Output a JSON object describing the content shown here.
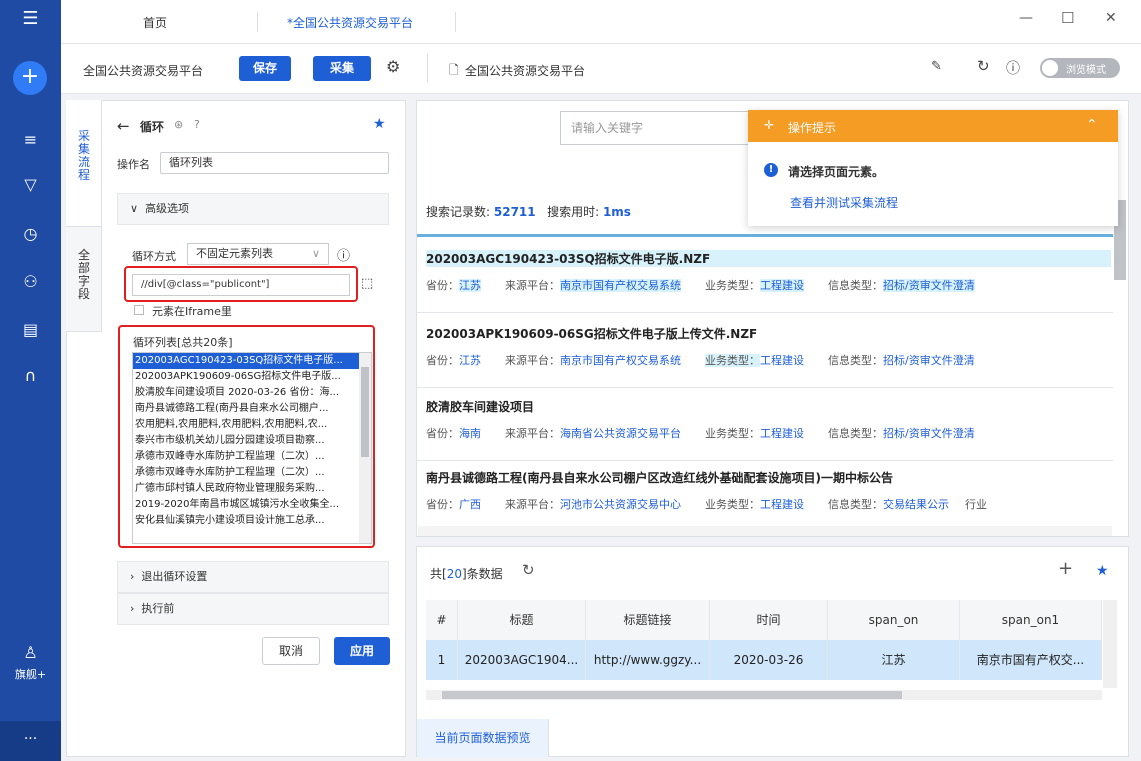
{
  "topbar": {
    "home_tab": "首页",
    "active_tab": "*全国公共资源交易平台",
    "minimize": "—",
    "maximize": "☐",
    "close": "✕"
  },
  "toolbar": {
    "task_name": "全国公共资源交易平台",
    "save": "保存",
    "collect": "采集",
    "url_title": "全国公共资源交易平台",
    "browse_mode": "浏览模式"
  },
  "rail": {
    "user_label": "旗舰+",
    "more": "···"
  },
  "left": {
    "vtab_flow": "采集流程",
    "vtab_fields": "全部字段",
    "title": "循环",
    "op_name_label": "操作名",
    "op_name_value": "循环列表",
    "advanced": "高级选项",
    "loop_mode_label": "循环方式",
    "loop_mode_value": "不固定元素列表",
    "xpath": "//div[@class=\"publicont\"]",
    "iframe_label": "元素在Iframe里",
    "loop_list_title": "循环列表[总共20条]",
    "loop_items": [
      "202003AGC190423-03SQ招标文件电子版...",
      "202003APK190609-06SG招标文件电子版...",
      "胶清胶车间建设项目 2020-03-26 省份：海...",
      "南丹县诚德路工程(南丹县自来水公司棚户...",
      "农用肥料,农用肥料,农用肥料,农用肥料,农...",
      "泰兴市市级机关幼儿园分园建设项目勘察...",
      "承德市双峰寺水库防护工程监理（二次）...",
      "承德市双峰寺水库防护工程监理（二次）...",
      "广德市邱村镇人民政府物业管理服务采购...",
      "2019-2020年南昌市城区城镇污水全收集全...",
      "安化县仙溪镇完小建设项目设计施工总承..."
    ],
    "exit_loop": "退出循环设置",
    "before_exec": "执行前",
    "cancel": "取消",
    "apply": "应用"
  },
  "right": {
    "search_placeholder": "请输入关键字",
    "stats_label1": "搜索记录数:",
    "stats_count": "52711",
    "stats_label2": "搜索用时:",
    "stats_time": "1ms",
    "records": [
      {
        "title": "202003AGC190423-03SQ招标文件电子版.NZF",
        "province": "江苏",
        "source": "南京市国有产权交易系统",
        "biz": "工程建设",
        "info": "招标/资审文件澄清"
      },
      {
        "title": "202003APK190609-06SG招标文件电子版上传文件.NZF",
        "province": "江苏",
        "source": "南京市国有产权交易系统",
        "biz": "工程建设",
        "info": "招标/资审文件澄清"
      },
      {
        "title": "胶清胶车间建设项目",
        "province": "海南",
        "source": "海南省公共资源交易平台",
        "biz": "工程建设",
        "info": "招标/资审文件澄清"
      },
      {
        "title": "南丹县诚德路工程(南丹县自来水公司棚户区改造红线外基础配套设施项目)一期中标公告",
        "province": "广西",
        "source": "河池市公共资源交易中心",
        "biz": "工程建设",
        "info": "交易结果公示",
        "extra": "行业"
      }
    ],
    "labels": {
      "province": "省份：",
      "source": "来源平台：",
      "biz": "业务类型：",
      "info": "信息类型："
    }
  },
  "tooltip": {
    "title": "操作提示",
    "msg": "请选择页面元素。",
    "link": "查看并测试采集流程"
  },
  "bottom": {
    "count_prefix": "共[",
    "count": "20",
    "count_suffix": "]条数据",
    "preview_tab": "当前页面数据预览",
    "headers": [
      "#",
      "标题",
      "标题链接",
      "时间",
      "span_on",
      "span_on1"
    ],
    "row": [
      "1",
      "202003AGC1904...",
      "http://www.ggzy...",
      "2020-03-26",
      "江苏",
      "南京市国有产权交..."
    ]
  }
}
